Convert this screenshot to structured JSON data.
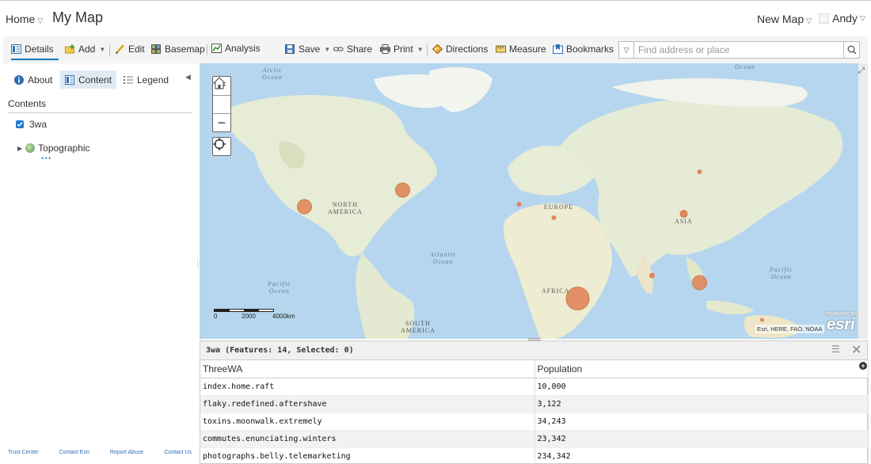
{
  "header": {
    "home_label": "Home",
    "home_caret": "▽",
    "title": "My Map",
    "new_map_label": "New Map",
    "new_map_caret": "▽",
    "user_name": "Andy",
    "user_caret": "▽"
  },
  "toolbar": {
    "details": "Details",
    "add": "Add",
    "edit": "Edit",
    "basemap": "Basemap",
    "analysis": "Analysis",
    "save": "Save",
    "share": "Share",
    "print": "Print",
    "directions": "Directions",
    "measure": "Measure",
    "bookmarks": "Bookmarks",
    "search_placeholder": "Find address or place",
    "search_value": ""
  },
  "panel": {
    "tabs": {
      "about": "About",
      "content": "Content",
      "legend": "Legend"
    },
    "active_tab": "Content",
    "contents_heading": "Contents",
    "layers": [
      {
        "name": "3wa",
        "checked": true
      },
      {
        "name": "Topographic",
        "basemap": true
      }
    ],
    "more": "•••",
    "footer": {
      "trust_center": "Trust Center",
      "contact_esri": "Contact Esri",
      "report_abuse": "Report Abuse",
      "contact_us": "Contact Us"
    }
  },
  "map": {
    "labels": {
      "arctic_ocean": "Arctic\nOcean",
      "ocean_top": "Ocean",
      "north_america": "NORTH\nAMERICA",
      "europe": "EUROPE",
      "asia": "ASIA",
      "africa": "AFRICA",
      "south_america": "SOUTH\nAMERICA",
      "atlantic": "Atlantic\nOcean",
      "pacific_left": "Pacific\nOcean",
      "pacific_right": "Pacific\nOcean"
    },
    "scale": {
      "l0": "0",
      "l1": "2000",
      "l2": "4000km"
    },
    "attribution": "Esri, HERE, FAO, NOAA",
    "esri_powered": "POWERED BY",
    "esri_logo": "esri",
    "colors": {
      "water": "#b5d6ee",
      "land": "#e8eddb",
      "symbol": "#e0875a"
    }
  },
  "table": {
    "title": "3wa (Features: 14, Selected: 0)",
    "columns": [
      "ThreeWA",
      "Population"
    ],
    "rows": [
      [
        "index.home.raft",
        "10,000"
      ],
      [
        "flaky.redefined.aftershave",
        "3,122"
      ],
      [
        "toxins.moonwalk.extremely",
        "34,243"
      ],
      [
        "commutes.enunciating.winters",
        "23,342"
      ],
      [
        "photographs.belly.telemarketing",
        "234,342"
      ]
    ]
  }
}
